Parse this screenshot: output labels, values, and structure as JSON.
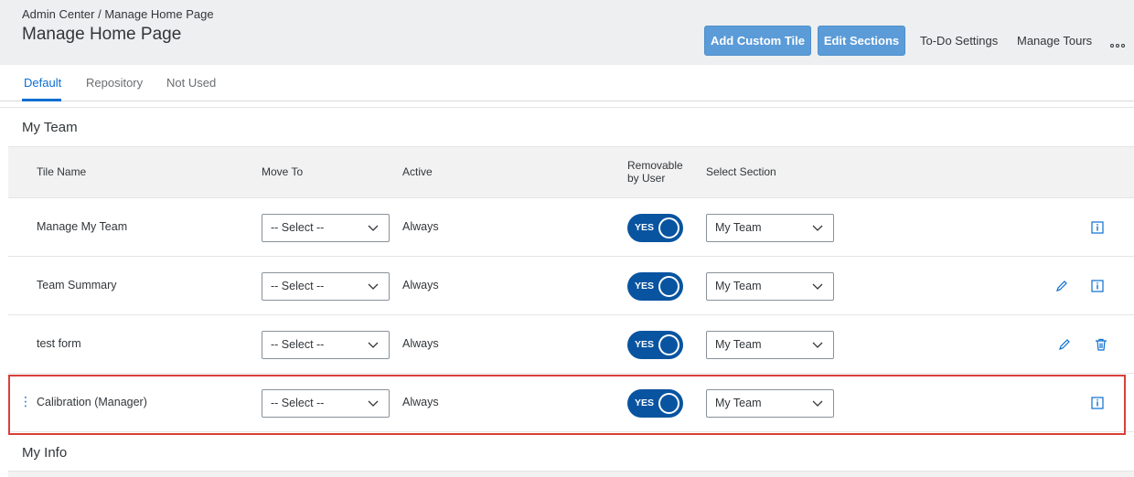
{
  "header": {
    "breadcrumb": "Admin Center / Manage Home Page",
    "title": "Manage Home Page",
    "buttons": {
      "add_custom_tile": "Add Custom Tile",
      "edit_sections": "Edit Sections",
      "todo_settings": "To-Do Settings",
      "manage_tours": "Manage Tours"
    },
    "overflow_icon": "more-horizontal-icon"
  },
  "tabs": [
    {
      "label": "Default",
      "active": true
    },
    {
      "label": "Repository",
      "active": false
    },
    {
      "label": "Not Used",
      "active": false
    }
  ],
  "sections": {
    "my_team": "My Team",
    "my_info": "My Info"
  },
  "table": {
    "headers": {
      "tile_name": "Tile Name",
      "move_to": "Move To",
      "active": "Active",
      "removable_line1": "Removable",
      "removable_line2": "by User",
      "select_section": "Select Section"
    },
    "rows": [
      {
        "name": "Manage My Team",
        "move_to": "-- Select --",
        "active": "Always",
        "removable": "YES",
        "section": "My Team",
        "actions": [
          "info-icon"
        ]
      },
      {
        "name": "Team Summary",
        "move_to": "-- Select --",
        "active": "Always",
        "removable": "YES",
        "section": "My Team",
        "actions": [
          "edit-icon",
          "info-icon"
        ]
      },
      {
        "name": "test form",
        "move_to": "-- Select --",
        "active": "Always",
        "removable": "YES",
        "section": "My Team",
        "actions": [
          "edit-icon",
          "delete-icon"
        ]
      },
      {
        "name": "Calibration (Manager)",
        "move_to": "-- Select --",
        "active": "Always",
        "removable": "YES",
        "section": "My Team",
        "actions": [
          "info-icon"
        ],
        "highlighted": true
      }
    ]
  },
  "colors": {
    "accent": "#0a6ed1",
    "toggle_on": "#0854a0",
    "emphasized_button": "#5b9bd8",
    "highlight_border": "#d9403a",
    "header_bg": "#edeff0"
  }
}
